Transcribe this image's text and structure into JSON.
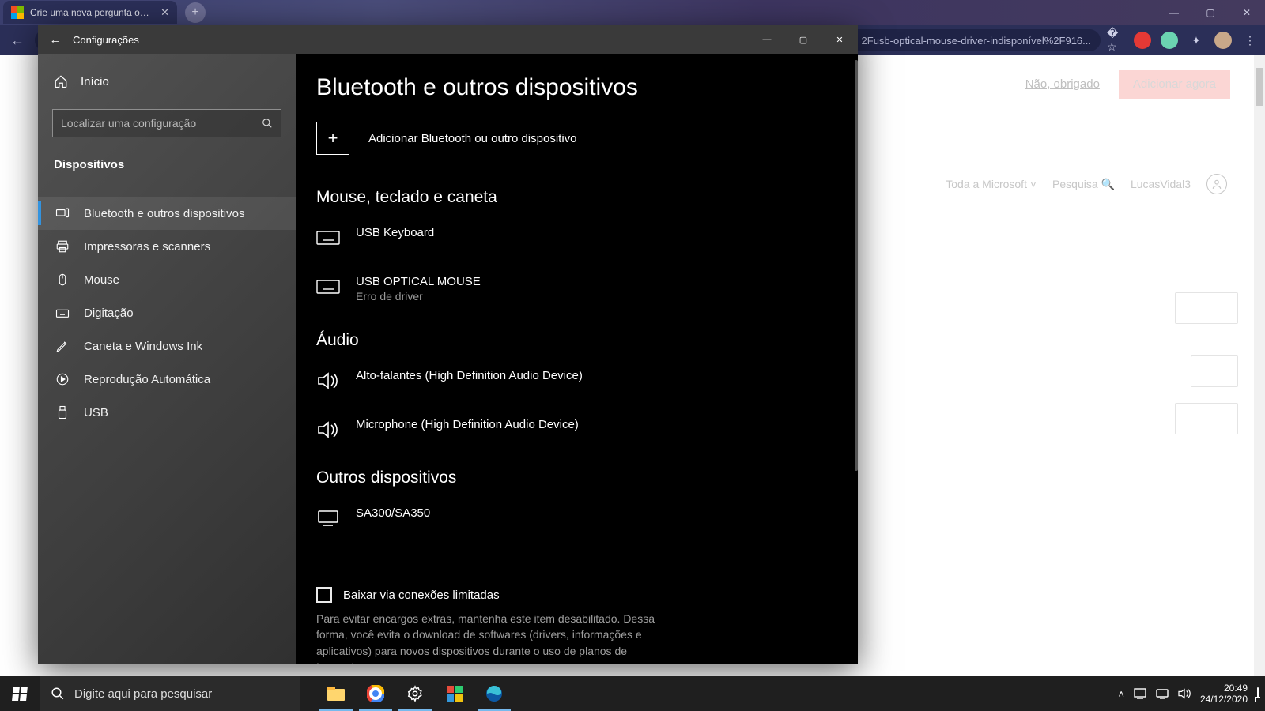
{
  "browser": {
    "tab_title": "Crie uma nova pergunta ou inicia",
    "omnibox_text": "2Fusb-optical-mouse-driver-indisponível%2F916...",
    "window_controls": {
      "min": "—",
      "max": "▢",
      "close": "✕"
    }
  },
  "page_behind": {
    "banner_dismiss": "Não, obrigado",
    "banner_cta": "Adicionar agora",
    "ms_all": "Toda a Microsoft",
    "search": "Pesquisa",
    "user": "LucasVidal3"
  },
  "settings": {
    "title": "Configurações",
    "home": "Início",
    "search_placeholder": "Localizar uma configuração",
    "category": "Dispositivos",
    "nav": {
      "bluetooth": "Bluetooth e outros dispositivos",
      "printers": "Impressoras e scanners",
      "mouse": "Mouse",
      "typing": "Digitação",
      "pen": "Caneta e Windows Ink",
      "autoplay": "Reprodução Automática",
      "usb": "USB"
    },
    "page": {
      "title": "Bluetooth e outros dispositivos",
      "add_device": "Adicionar Bluetooth ou outro dispositivo",
      "section_input": "Mouse, teclado e caneta",
      "device_keyboard": "USB Keyboard",
      "device_mouse": "USB OPTICAL MOUSE",
      "device_mouse_sub": "Erro de driver",
      "section_audio": "Áudio",
      "device_speakers": "Alto-falantes (High Definition Audio Device)",
      "device_mic": "Microphone (High Definition Audio Device)",
      "section_other": "Outros dispositivos",
      "device_monitor": "SA300/SA350",
      "metered_checkbox": "Baixar via conexões limitadas",
      "metered_desc": "Para evitar encargos extras, mantenha este item desabilitado. Dessa forma, você evita o download de softwares (drivers, informações e aplicativos) para novos dispositivos durante o uso de planos de Internet"
    }
  },
  "taskbar": {
    "search_placeholder": "Digite aqui para pesquisar",
    "time": "20:49",
    "date": "24/12/2020"
  }
}
